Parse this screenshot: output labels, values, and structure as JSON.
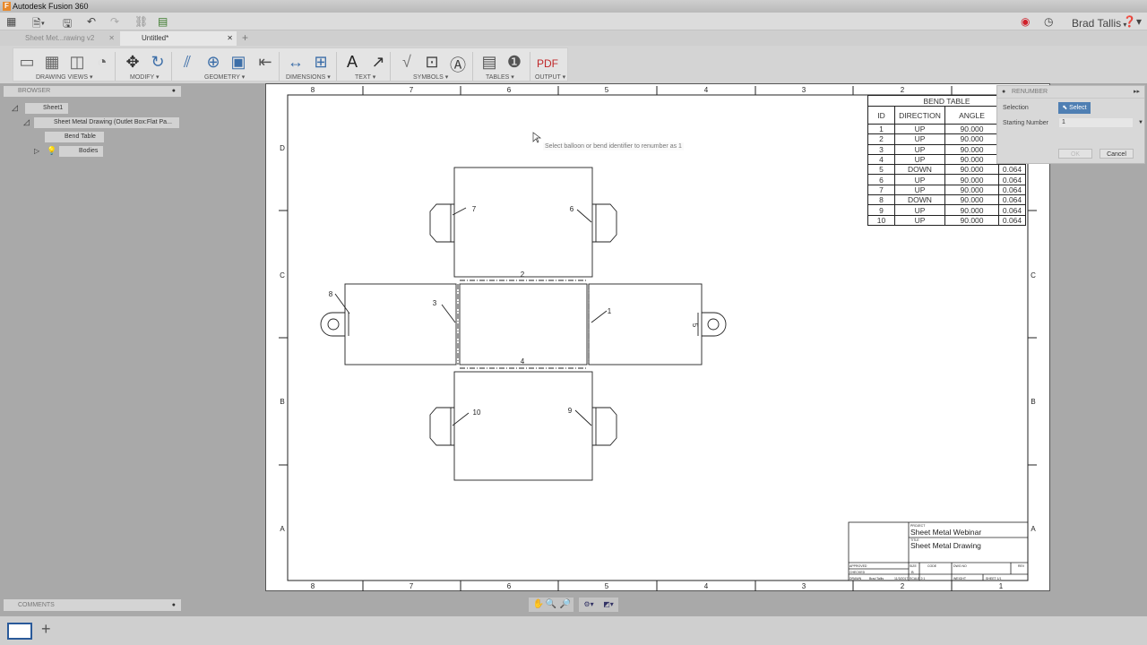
{
  "app": {
    "title": "Autodesk Fusion 360",
    "user": "Brad Tallis"
  },
  "tabs": [
    {
      "label": "Sheet Met...rawing v2"
    },
    {
      "label": "Untitled*"
    }
  ],
  "ribbon": {
    "groups": [
      "DRAWING VIEWS ▾",
      "MODIFY ▾",
      "GEOMETRY ▾",
      "DIMENSIONS ▾",
      "TEXT ▾",
      "SYMBOLS ▾",
      "TABLES ▾",
      "OUTPUT ▾"
    ]
  },
  "browser": {
    "title": "BROWSER",
    "items": [
      "Sheet1",
      "Sheet Metal Drawing (Outlet Box:Flat Pa...",
      "Bend Table",
      "Bodies"
    ]
  },
  "comments": {
    "title": "COMMENTS"
  },
  "sheet": {
    "zones_x": [
      "8",
      "7",
      "6",
      "5",
      "4",
      "3",
      "2",
      "1"
    ],
    "zones_y": [
      "D",
      "C",
      "B",
      "A"
    ]
  },
  "bend_table": {
    "title": "BEND TABLE",
    "headers": [
      "ID",
      "DIRECTION",
      "ANGLE",
      ""
    ],
    "rows": [
      [
        "1",
        "UP",
        "90.000",
        ""
      ],
      [
        "2",
        "UP",
        "90.000",
        ""
      ],
      [
        "3",
        "UP",
        "90.000",
        ""
      ],
      [
        "4",
        "UP",
        "90.000",
        ""
      ],
      [
        "5",
        "DOWN",
        "90.000",
        "0.064"
      ],
      [
        "6",
        "UP",
        "90.000",
        "0.064"
      ],
      [
        "7",
        "UP",
        "90.000",
        "0.064"
      ],
      [
        "8",
        "DOWN",
        "90.000",
        "0.064"
      ],
      [
        "9",
        "UP",
        "90.000",
        "0.064"
      ],
      [
        "10",
        "UP",
        "90.000",
        "0.064"
      ]
    ]
  },
  "balloons": [
    "1",
    "2",
    "3",
    "4",
    "5",
    "6",
    "7",
    "8",
    "9",
    "10"
  ],
  "title_block": {
    "project_label": "PROJECT",
    "project": "Sheet Metal Webinar",
    "title_label": "TITLE",
    "title": "Sheet Metal Drawing",
    "approved": "APPROVED",
    "checked": "CHECKED",
    "drawn": "DRAWN",
    "drawn_by": "Brad Tallis",
    "date": "11/3/2017",
    "size_label": "SIZE",
    "size": "B",
    "code": "CODE",
    "dwg_no": "DWG NO",
    "rev": "REV",
    "scale": "SCALE 2:1",
    "weight": "WEIGHT",
    "sheet": "SHEET 1/1"
  },
  "tooltip": "Select balloon or bend identifier to renumber as 1",
  "dialog": {
    "title": "RENUMBER",
    "selection_label": "Selection",
    "select_button": "Select",
    "starting_number_label": "Starting Number",
    "starting_number": "1",
    "ok": "OK",
    "cancel": "Cancel"
  },
  "colors": {
    "accent": "#4f7fb3",
    "record": "#d0202a"
  }
}
